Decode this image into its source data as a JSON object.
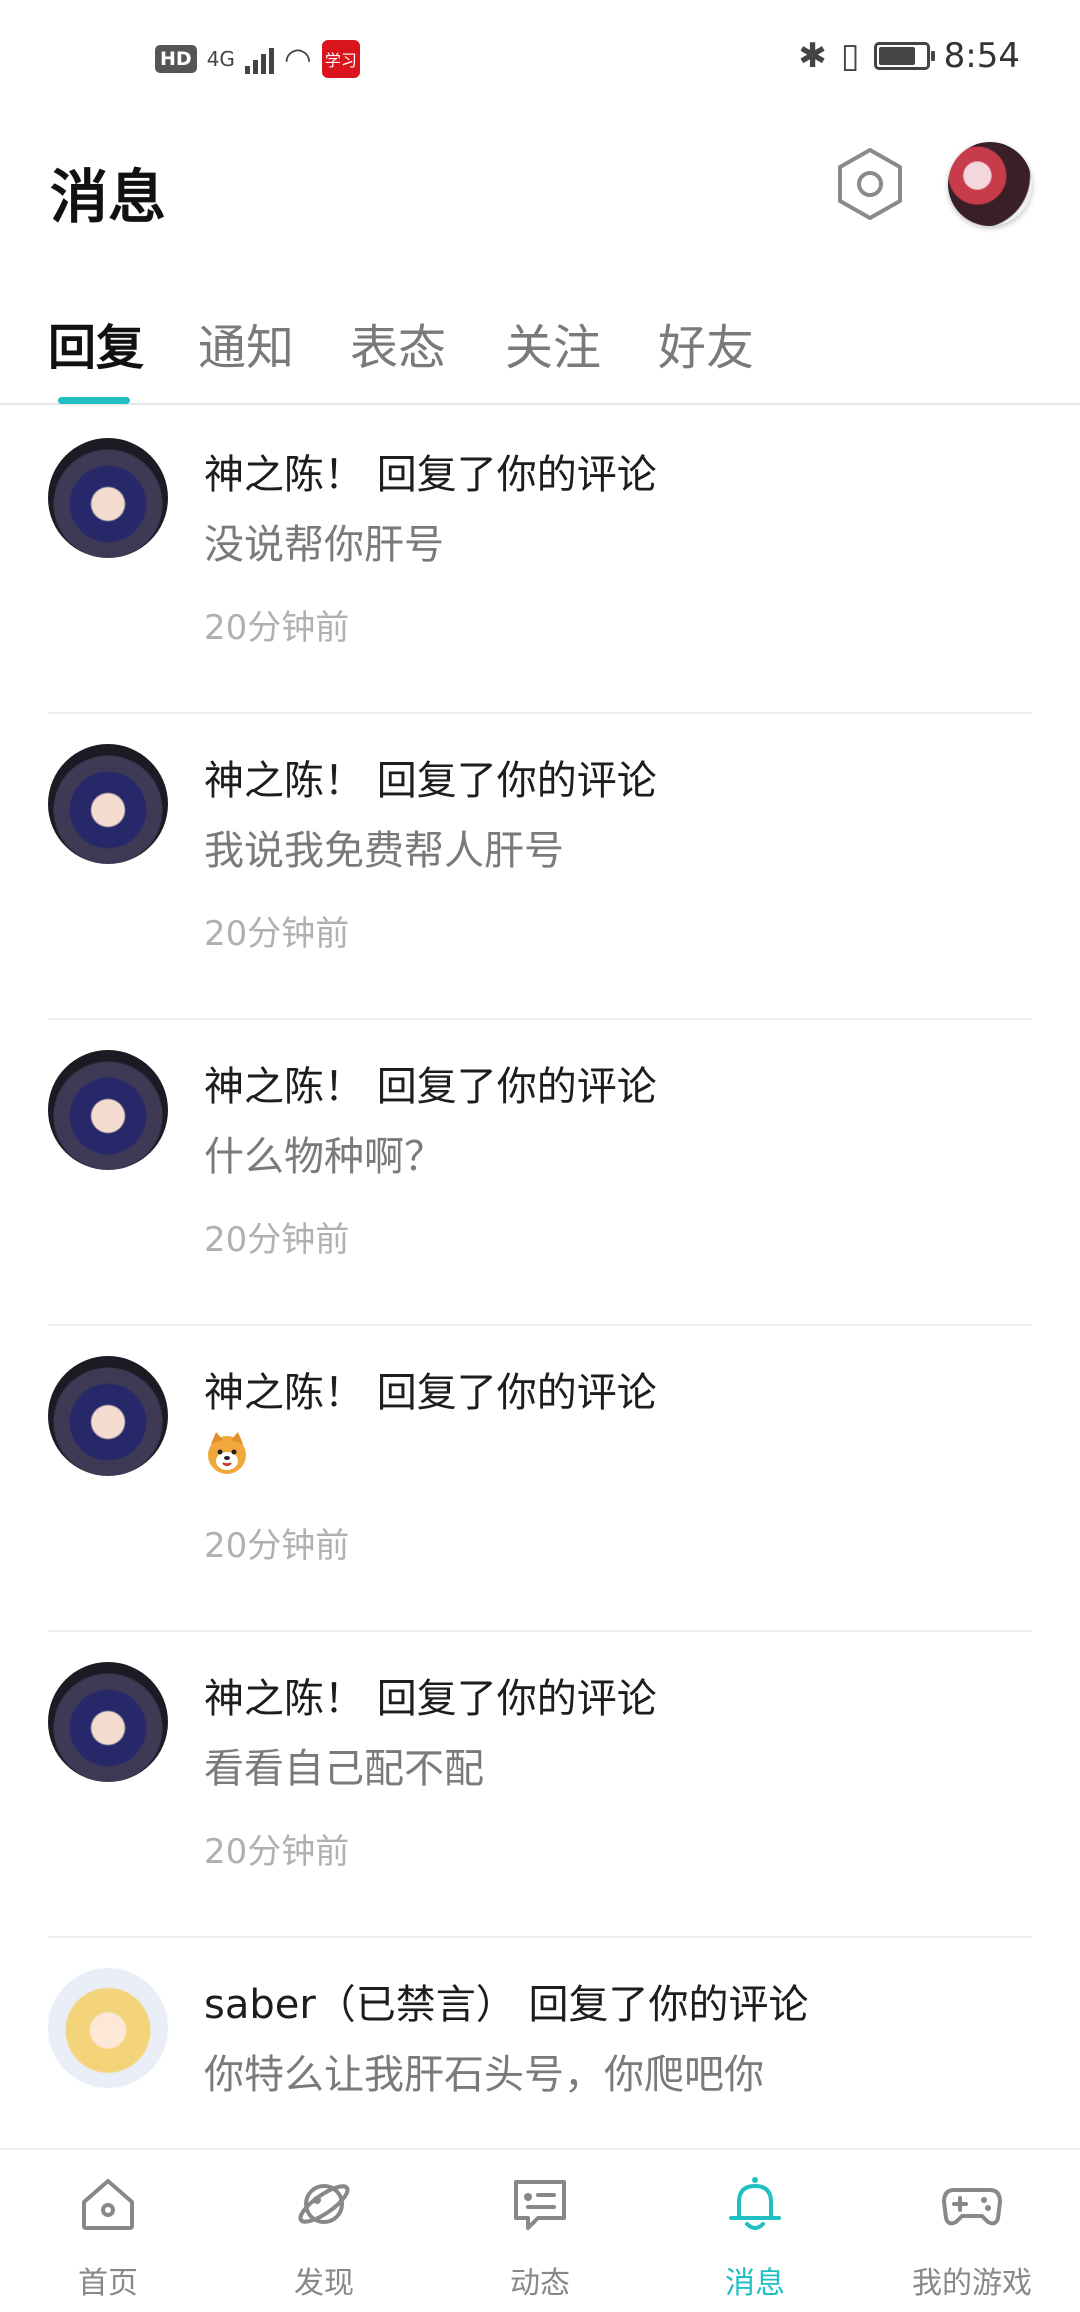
{
  "status_bar": {
    "hd": "HD",
    "network": "4G",
    "app_badge": "学习",
    "time": "8:54",
    "battery_level": 0.8
  },
  "header": {
    "title": "消息"
  },
  "tabs": [
    {
      "label": "回复",
      "active": true
    },
    {
      "label": "通知",
      "active": false
    },
    {
      "label": "表态",
      "active": false
    },
    {
      "label": "关注",
      "active": false
    },
    {
      "label": "好友",
      "active": false
    }
  ],
  "messages": [
    {
      "user": "神之陈！",
      "action": "回复了你的评论",
      "text": "没说帮你肝号",
      "time": "20分钟前",
      "avatar": "chen"
    },
    {
      "user": "神之陈！",
      "action": "回复了你的评论",
      "text": "我说我免费帮人肝号",
      "time": "20分钟前",
      "avatar": "chen"
    },
    {
      "user": "神之陈！",
      "action": "回复了你的评论",
      "text": "什么物种啊？",
      "time": "20分钟前",
      "avatar": "chen"
    },
    {
      "user": "神之陈！",
      "action": "回复了你的评论",
      "text": "",
      "emoji": "shiba-dog",
      "time": "20分钟前",
      "avatar": "chen"
    },
    {
      "user": "神之陈！",
      "action": "回复了你的评论",
      "text": "看看自己配不配",
      "time": "20分钟前",
      "avatar": "chen"
    },
    {
      "user": "saber（已禁言）",
      "action": "回复了你的评论",
      "text": "你特么让我肝石头号，你爬吧你",
      "time": "",
      "avatar": "saber"
    }
  ],
  "bottom_nav": [
    {
      "label": "首页",
      "icon": "home-icon",
      "active": false
    },
    {
      "label": "发现",
      "icon": "planet-icon",
      "active": false
    },
    {
      "label": "动态",
      "icon": "chat-card-icon",
      "active": false
    },
    {
      "label": "消息",
      "icon": "bell-icon",
      "active": true
    },
    {
      "label": "我的游戏",
      "icon": "gamepad-icon",
      "active": false
    }
  ],
  "colors": {
    "accent": "#1fbfc2",
    "text_primary": "#1d1d1d",
    "text_secondary": "#7a7a7a",
    "text_muted": "#b0b0b0"
  }
}
